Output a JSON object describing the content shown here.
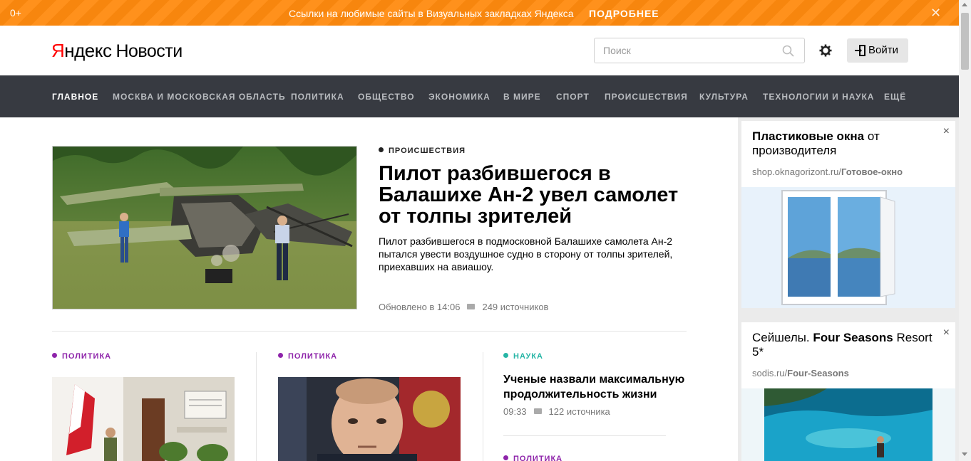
{
  "promo": {
    "age": "0+",
    "message": "Ссылки на любимые сайты в Визуальных закладках Яндекса",
    "more": "ПОДРОБНЕЕ",
    "close": "✕"
  },
  "header": {
    "logo_ya": "Я",
    "logo_brand": "ндекс",
    "logo_service": "Новости",
    "search_placeholder": "Поиск",
    "login": "Войти"
  },
  "nav": {
    "items": [
      "ГЛАВНОЕ",
      "МОСКВА И МОСКОВСКАЯ ОБЛАСТЬ",
      "ПОЛИТИКА",
      "ОБЩЕСТВО",
      "ЭКОНОМИКА",
      "В МИРЕ",
      "СПОРТ",
      "ПРОИСШЕСТВИЯ",
      "КУЛЬТУРА",
      "ТЕХНОЛОГИИ И НАУКА",
      "ЕЩЁ"
    ],
    "active": "ГЛАВНОЕ"
  },
  "main_story": {
    "rubric": "ПРОИСШЕСТВИЯ",
    "title": "Пилот разбившегося в Балашихе Ан-2 увел самолет от толпы зрителей",
    "annotation": "Пилот разбившегося в подмосковной Балашихе самолета Ан-2 пытался увести воздушное судно в сторону от толпы зрителей, приехавших на авиашоу.",
    "updated": "Обновлено в 14:06",
    "sources": "249 источников"
  },
  "cards": [
    {
      "rubric": "ПОЛИТИКА",
      "color": "#8e24aa"
    },
    {
      "rubric": "ПОЛИТИКА",
      "color": "#8e24aa"
    },
    {
      "rubric": "НАУКА",
      "color": "#26b5a5",
      "title": "Ученые назвали максимальную продолжительность жизни",
      "time": "09:33",
      "sources": "122 источника"
    },
    {
      "rubric": "ПОЛИТИКА",
      "color": "#8e24aa"
    }
  ],
  "ads": [
    {
      "title_bold": "Пластиковые окна",
      "title_rest": " от производителя",
      "domain_plain": "shop.oknagorizont.ru/",
      "domain_bold": "Готовое-окно",
      "close": "×"
    },
    {
      "title_plain": "Сейшелы. ",
      "title_bold": "Four Seasons",
      "title_rest": " Resort 5*",
      "domain_plain": "sodis.ru/",
      "domain_bold": "Four-Seasons",
      "close": "×"
    }
  ],
  "colors": {
    "promo": "#ff8a0e",
    "nav": "#373a41",
    "politics": "#8e24aa",
    "science": "#26b5a5"
  }
}
